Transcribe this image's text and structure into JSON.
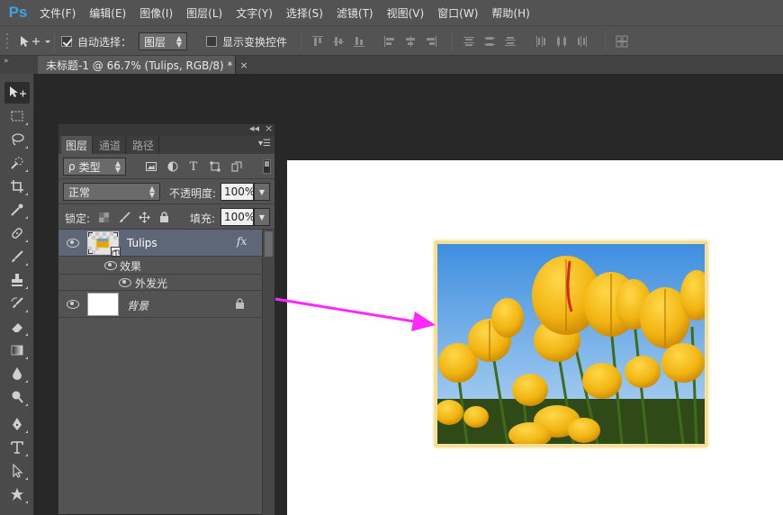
{
  "app": {
    "logo": "Ps"
  },
  "menu": [
    "文件(F)",
    "编辑(E)",
    "图像(I)",
    "图层(L)",
    "文字(Y)",
    "选择(S)",
    "滤镜(T)",
    "视图(V)",
    "窗口(W)",
    "帮助(H)"
  ],
  "options": {
    "auto_select_label": "自动选择：",
    "auto_select_checked": true,
    "auto_select_value": "图层",
    "show_transform_label": "显示变换控件",
    "show_transform_checked": false
  },
  "document": {
    "tab_title": "未标题-1 @ 66.7% (Tulips, RGB/8) *",
    "close_glyph": "×"
  },
  "layers_panel": {
    "tabs": [
      "图层",
      "通道",
      "路径"
    ],
    "active_tab": 0,
    "filter_label": "类型",
    "search_glyph": "ρ",
    "blend_mode": "正常",
    "opacity_label": "不透明度:",
    "opacity_value": "100%",
    "lock_label": "锁定:",
    "fill_label": "填充:",
    "fill_value": "100%",
    "layers": [
      {
        "name": "Tulips",
        "fx": "fx",
        "selected": true,
        "visible": true
      },
      {
        "name": "背景",
        "locked": true,
        "visible": true
      }
    ],
    "effects_label": "效果",
    "effect_items": [
      "外发光"
    ]
  },
  "annotation": {
    "arrow_color": "#ff29ff"
  },
  "colors": {
    "ui_dark": "#282828",
    "ui_panel": "#535353",
    "selected_layer": "#5d6778",
    "glow": "#f2c84a",
    "ps_blue": "#3ba3e8"
  }
}
